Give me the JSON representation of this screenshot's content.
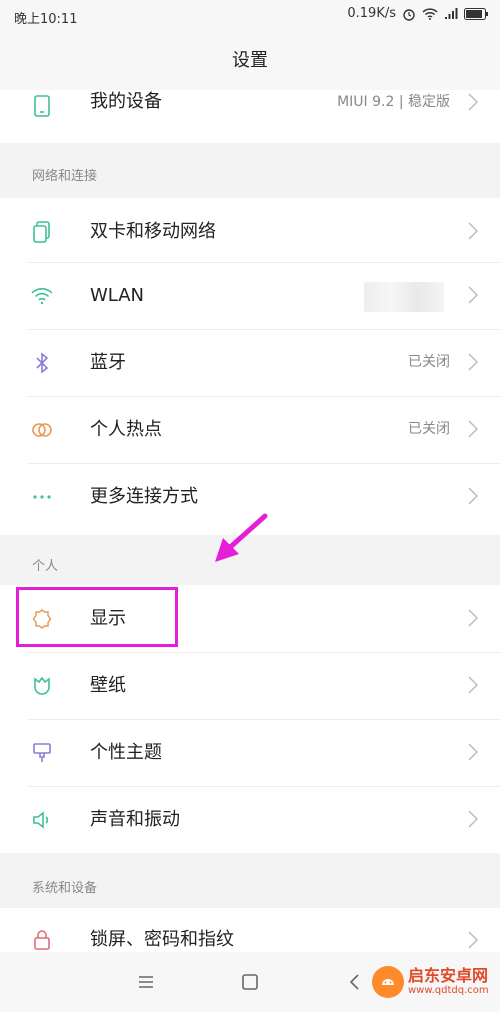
{
  "status": {
    "time": "晚上10:11",
    "speed": "0.19K/s"
  },
  "title": "设置",
  "device_row": {
    "label": "我的设备",
    "value": "MIUI 9.2 | 稳定版"
  },
  "sections": {
    "network": "网络和连接",
    "personal": "个人",
    "system": "系统和设备"
  },
  "network_items": [
    {
      "label": "双卡和移动网络",
      "value": ""
    },
    {
      "label": "WLAN",
      "value": ""
    },
    {
      "label": "蓝牙",
      "value": "已关闭"
    },
    {
      "label": "个人热点",
      "value": "已关闭"
    },
    {
      "label": "更多连接方式",
      "value": ""
    }
  ],
  "personal_items": [
    {
      "label": "显示"
    },
    {
      "label": "壁纸"
    },
    {
      "label": "个性主题"
    },
    {
      "label": "声音和振动"
    }
  ],
  "system_items": [
    {
      "label": "锁屏、密码和指纹"
    }
  ],
  "watermark": {
    "name": "启东安卓网",
    "url": "www.qdtdq.com"
  },
  "colors": {
    "highlight": "#e51ed8",
    "icon_green": "#3fbf9a",
    "icon_orange": "#e89a5a",
    "icon_purple": "#8a7fd8",
    "icon_pink": "#e46a7a"
  }
}
